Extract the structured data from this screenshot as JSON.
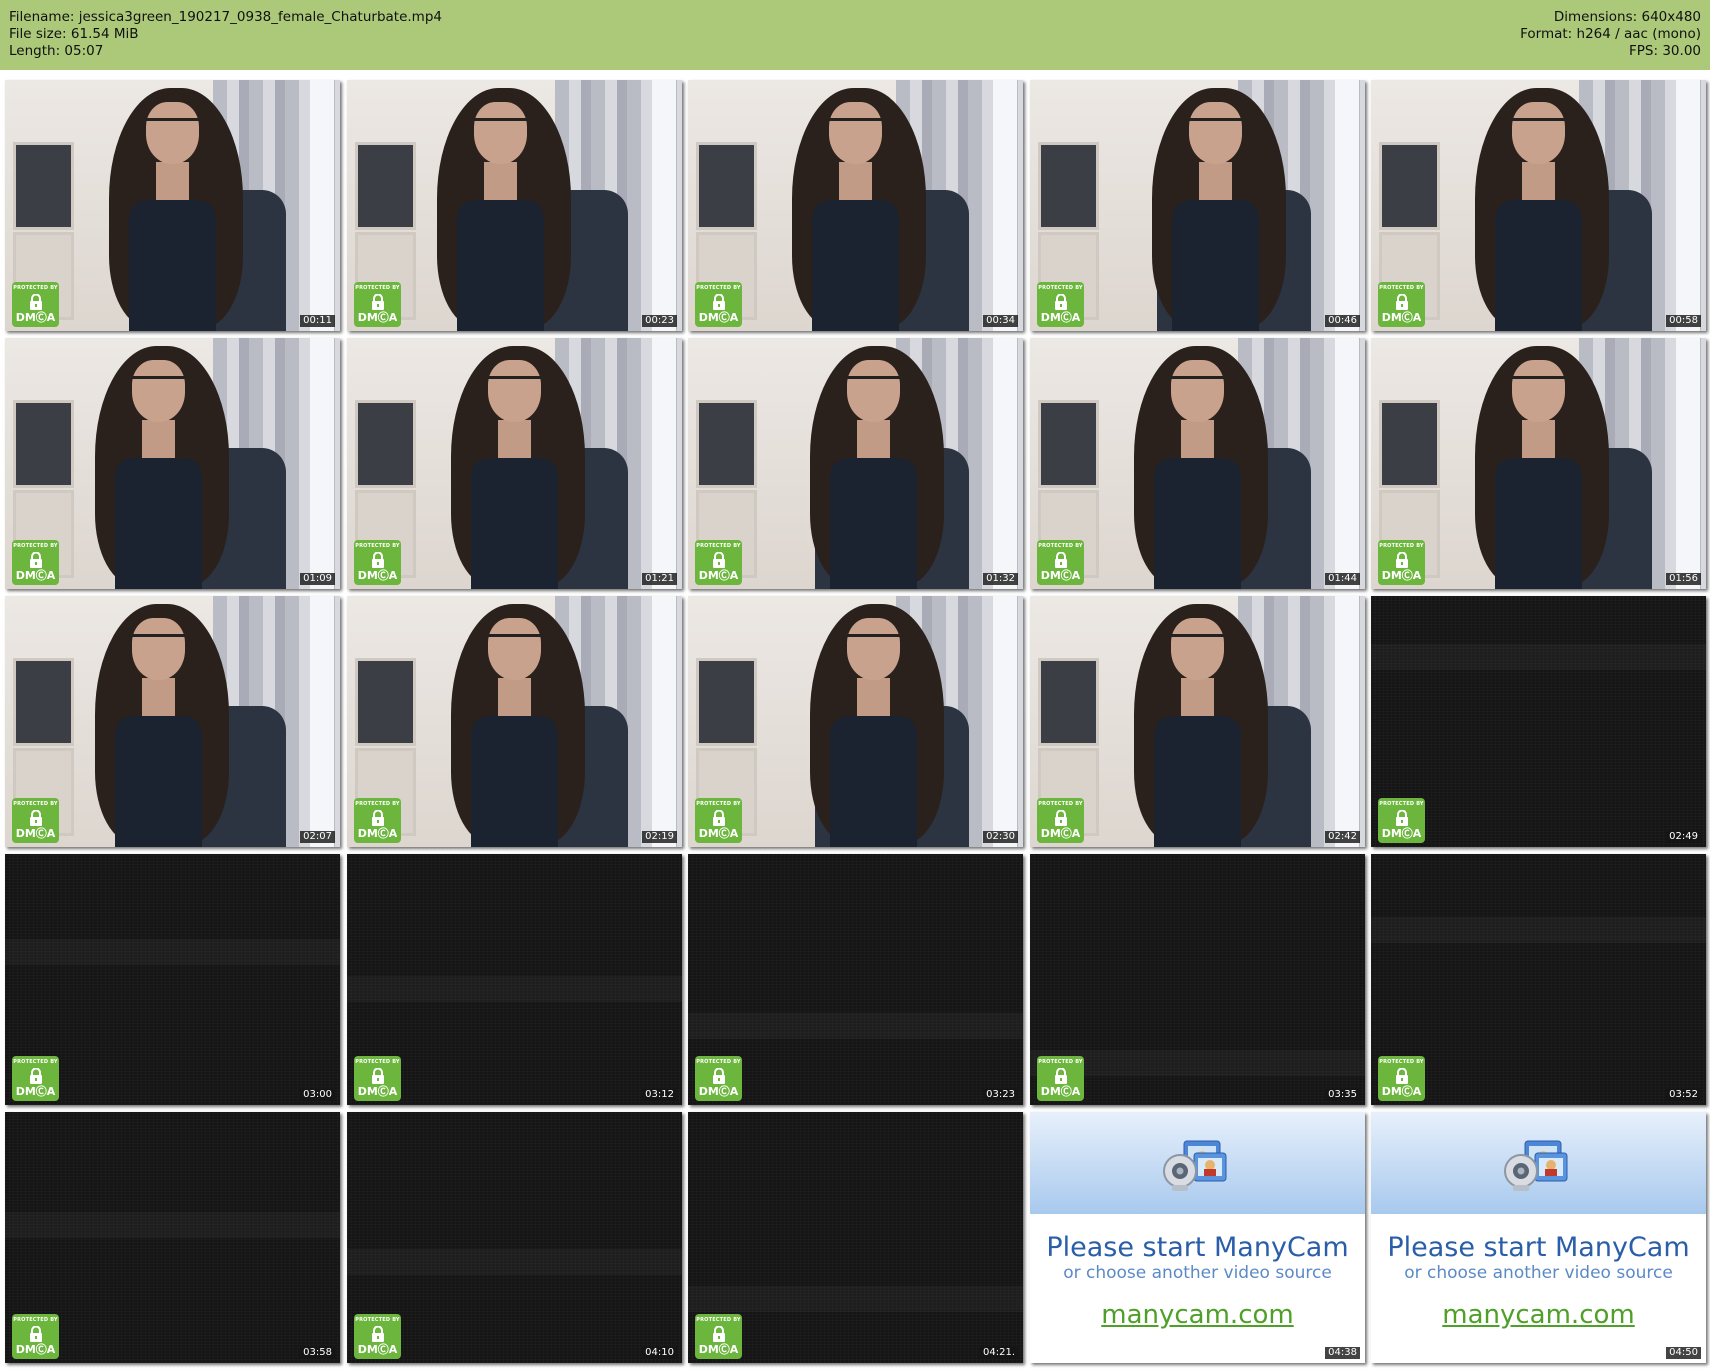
{
  "header": {
    "filename": "Filename: jessica3green_190217_0938_female_Chaturbate.mp4",
    "filesize": "File size: 61.54 MiB",
    "length": "Length: 05:07",
    "dimensions": "Dimensions: 640x480",
    "format": "Format: h264 / aac (mono)",
    "fps": "FPS: 30.00"
  },
  "colors": {
    "header_bg": "#acc97a",
    "dmca_green": "#6cb63d",
    "manycam_blue": "#2a5ea8",
    "manycam_link": "#4fa028"
  },
  "dmca": {
    "protected_by": "PROTECTED BY",
    "brand": "DMⒸA",
    "icon": "lock-icon"
  },
  "manycam": {
    "line1": "Please start ManyCam",
    "line2": "or choose another video source",
    "link": "manycam.com",
    "icon": "webcam-icon"
  },
  "thumbnails": [
    {
      "time": "00:11",
      "kind": "cam"
    },
    {
      "time": "00:23",
      "kind": "cam"
    },
    {
      "time": "00:34",
      "kind": "cam"
    },
    {
      "time": "00:46",
      "kind": "cam"
    },
    {
      "time": "00:58",
      "kind": "cam"
    },
    {
      "time": "01:09",
      "kind": "cam"
    },
    {
      "time": "01:21",
      "kind": "cam"
    },
    {
      "time": "01:32",
      "kind": "cam"
    },
    {
      "time": "01:44",
      "kind": "cam"
    },
    {
      "time": "01:56",
      "kind": "cam"
    },
    {
      "time": "02:07",
      "kind": "cam"
    },
    {
      "time": "02:19",
      "kind": "cam"
    },
    {
      "time": "02:30",
      "kind": "cam"
    },
    {
      "time": "02:42",
      "kind": "cam"
    },
    {
      "time": "02:49",
      "kind": "dark"
    },
    {
      "time": "03:00",
      "kind": "dark"
    },
    {
      "time": "03:12",
      "kind": "dark"
    },
    {
      "time": "03:23",
      "kind": "dark"
    },
    {
      "time": "03:35",
      "kind": "dark"
    },
    {
      "time": "03:52",
      "kind": "dark"
    },
    {
      "time": "03:58",
      "kind": "dark"
    },
    {
      "time": "04:10",
      "kind": "dark"
    },
    {
      "time": "04:21.",
      "kind": "dark"
    },
    {
      "time": "04:38",
      "kind": "manycam"
    },
    {
      "time": "04:50",
      "kind": "manycam"
    }
  ]
}
